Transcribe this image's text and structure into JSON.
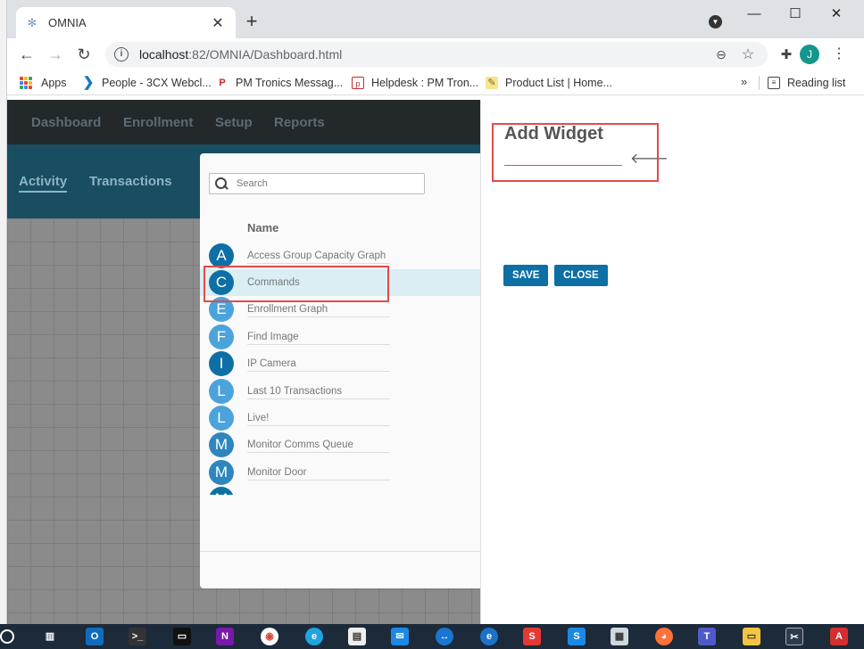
{
  "browser": {
    "tab_title": "OMNIA",
    "new_tab": "+",
    "url_host": "localhost",
    "url_rest": ":82/OMNIA/Dashboard.html",
    "avatar_initial": "J"
  },
  "bookmarks": {
    "items": [
      {
        "label": "Apps"
      },
      {
        "label": "People - 3CX Webcl..."
      },
      {
        "label": "PM Tronics Messag..."
      },
      {
        "label": "Helpdesk : PM Tron..."
      },
      {
        "label": "Product List | Home..."
      }
    ],
    "more": "»",
    "reading_list": "Reading list"
  },
  "app": {
    "nav": [
      "Dashboard",
      "Enrollment",
      "Setup",
      "Reports"
    ],
    "subnav": [
      "Activity",
      "Transactions"
    ]
  },
  "picker": {
    "search_placeholder": "Search",
    "column_header": "Name",
    "items": [
      {
        "letter": "A",
        "label": "Access Group Capacity Graph",
        "color": "#0e6fa5"
      },
      {
        "letter": "C",
        "label": "Commands",
        "color": "#0e6fa5"
      },
      {
        "letter": "E",
        "label": "Enrollment Graph",
        "color": "#4ba3db"
      },
      {
        "letter": "F",
        "label": "Find Image",
        "color": "#4ba3db"
      },
      {
        "letter": "I",
        "label": "IP Camera",
        "color": "#0e6fa5"
      },
      {
        "letter": "L",
        "label": "Last 10 Transactions",
        "color": "#4ba3db"
      },
      {
        "letter": "L",
        "label": "Live!",
        "color": "#4ba3db"
      },
      {
        "letter": "M",
        "label": "Monitor Comms Queue",
        "color": "#2f86be"
      },
      {
        "letter": "M",
        "label": "Monitor Door",
        "color": "#2f86be"
      },
      {
        "letter": "M",
        "label": "",
        "color": "#0e6fa5"
      }
    ],
    "selected_index": 1
  },
  "side_panel": {
    "title": "Add Widget",
    "input_value": "",
    "save_label": "SAVE",
    "close_label": "CLOSE"
  },
  "colors": {
    "accent": "#0e6fa5",
    "highlight": "#e34b4b"
  }
}
